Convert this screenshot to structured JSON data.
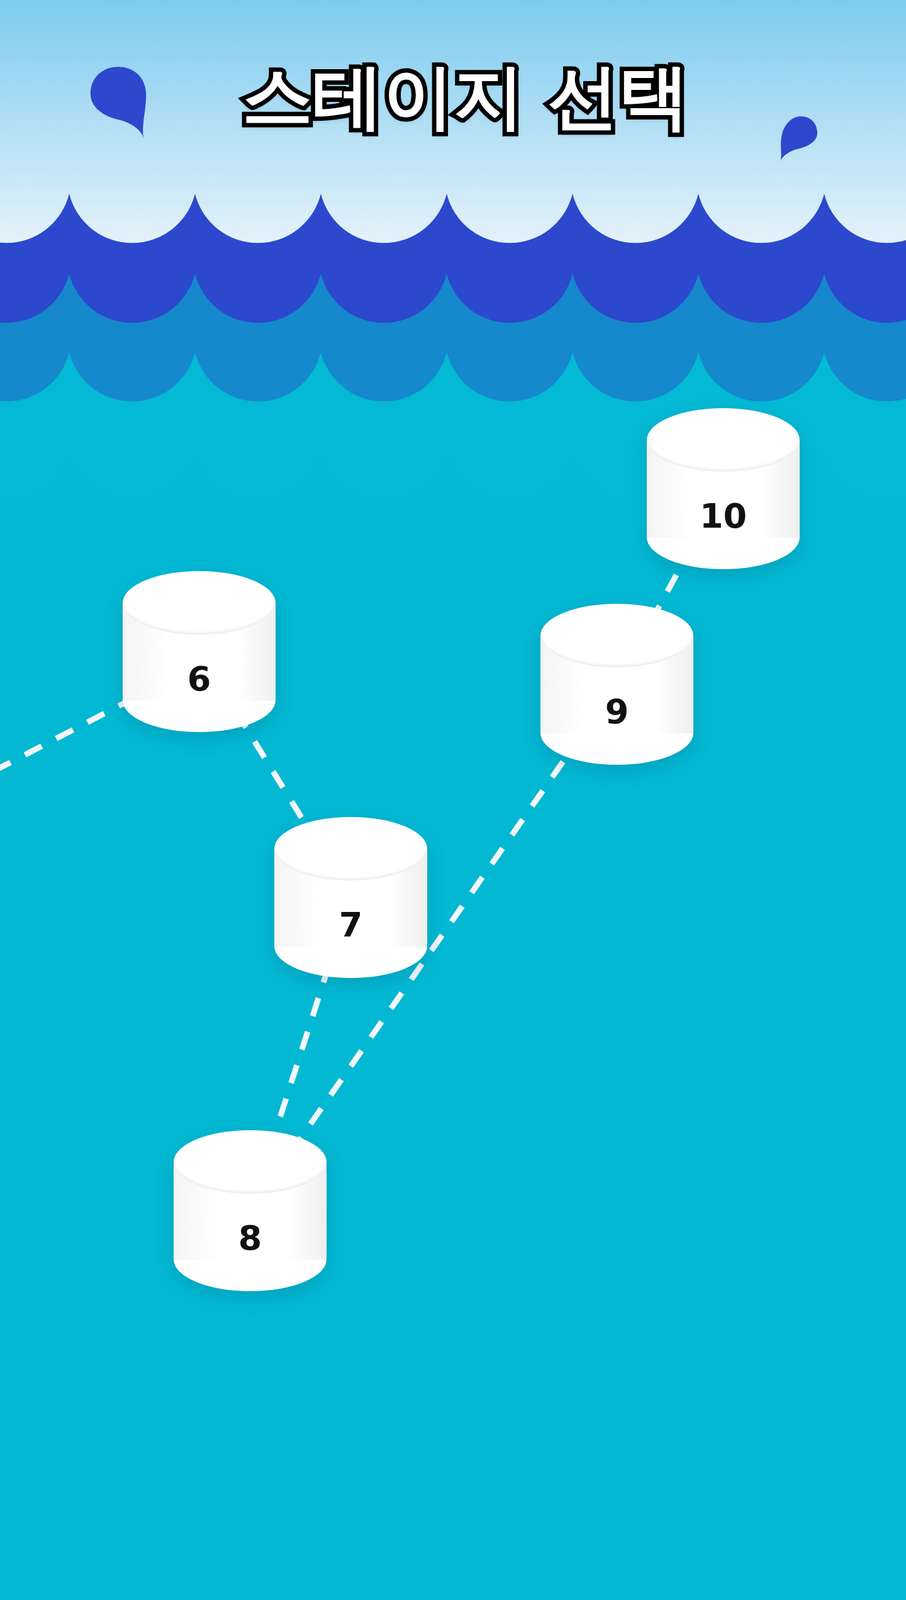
{
  "title": "스테이지 선택",
  "stages": [
    {
      "label": "6"
    },
    {
      "label": "7"
    },
    {
      "label": "8"
    },
    {
      "label": "9"
    },
    {
      "label": "10"
    }
  ]
}
